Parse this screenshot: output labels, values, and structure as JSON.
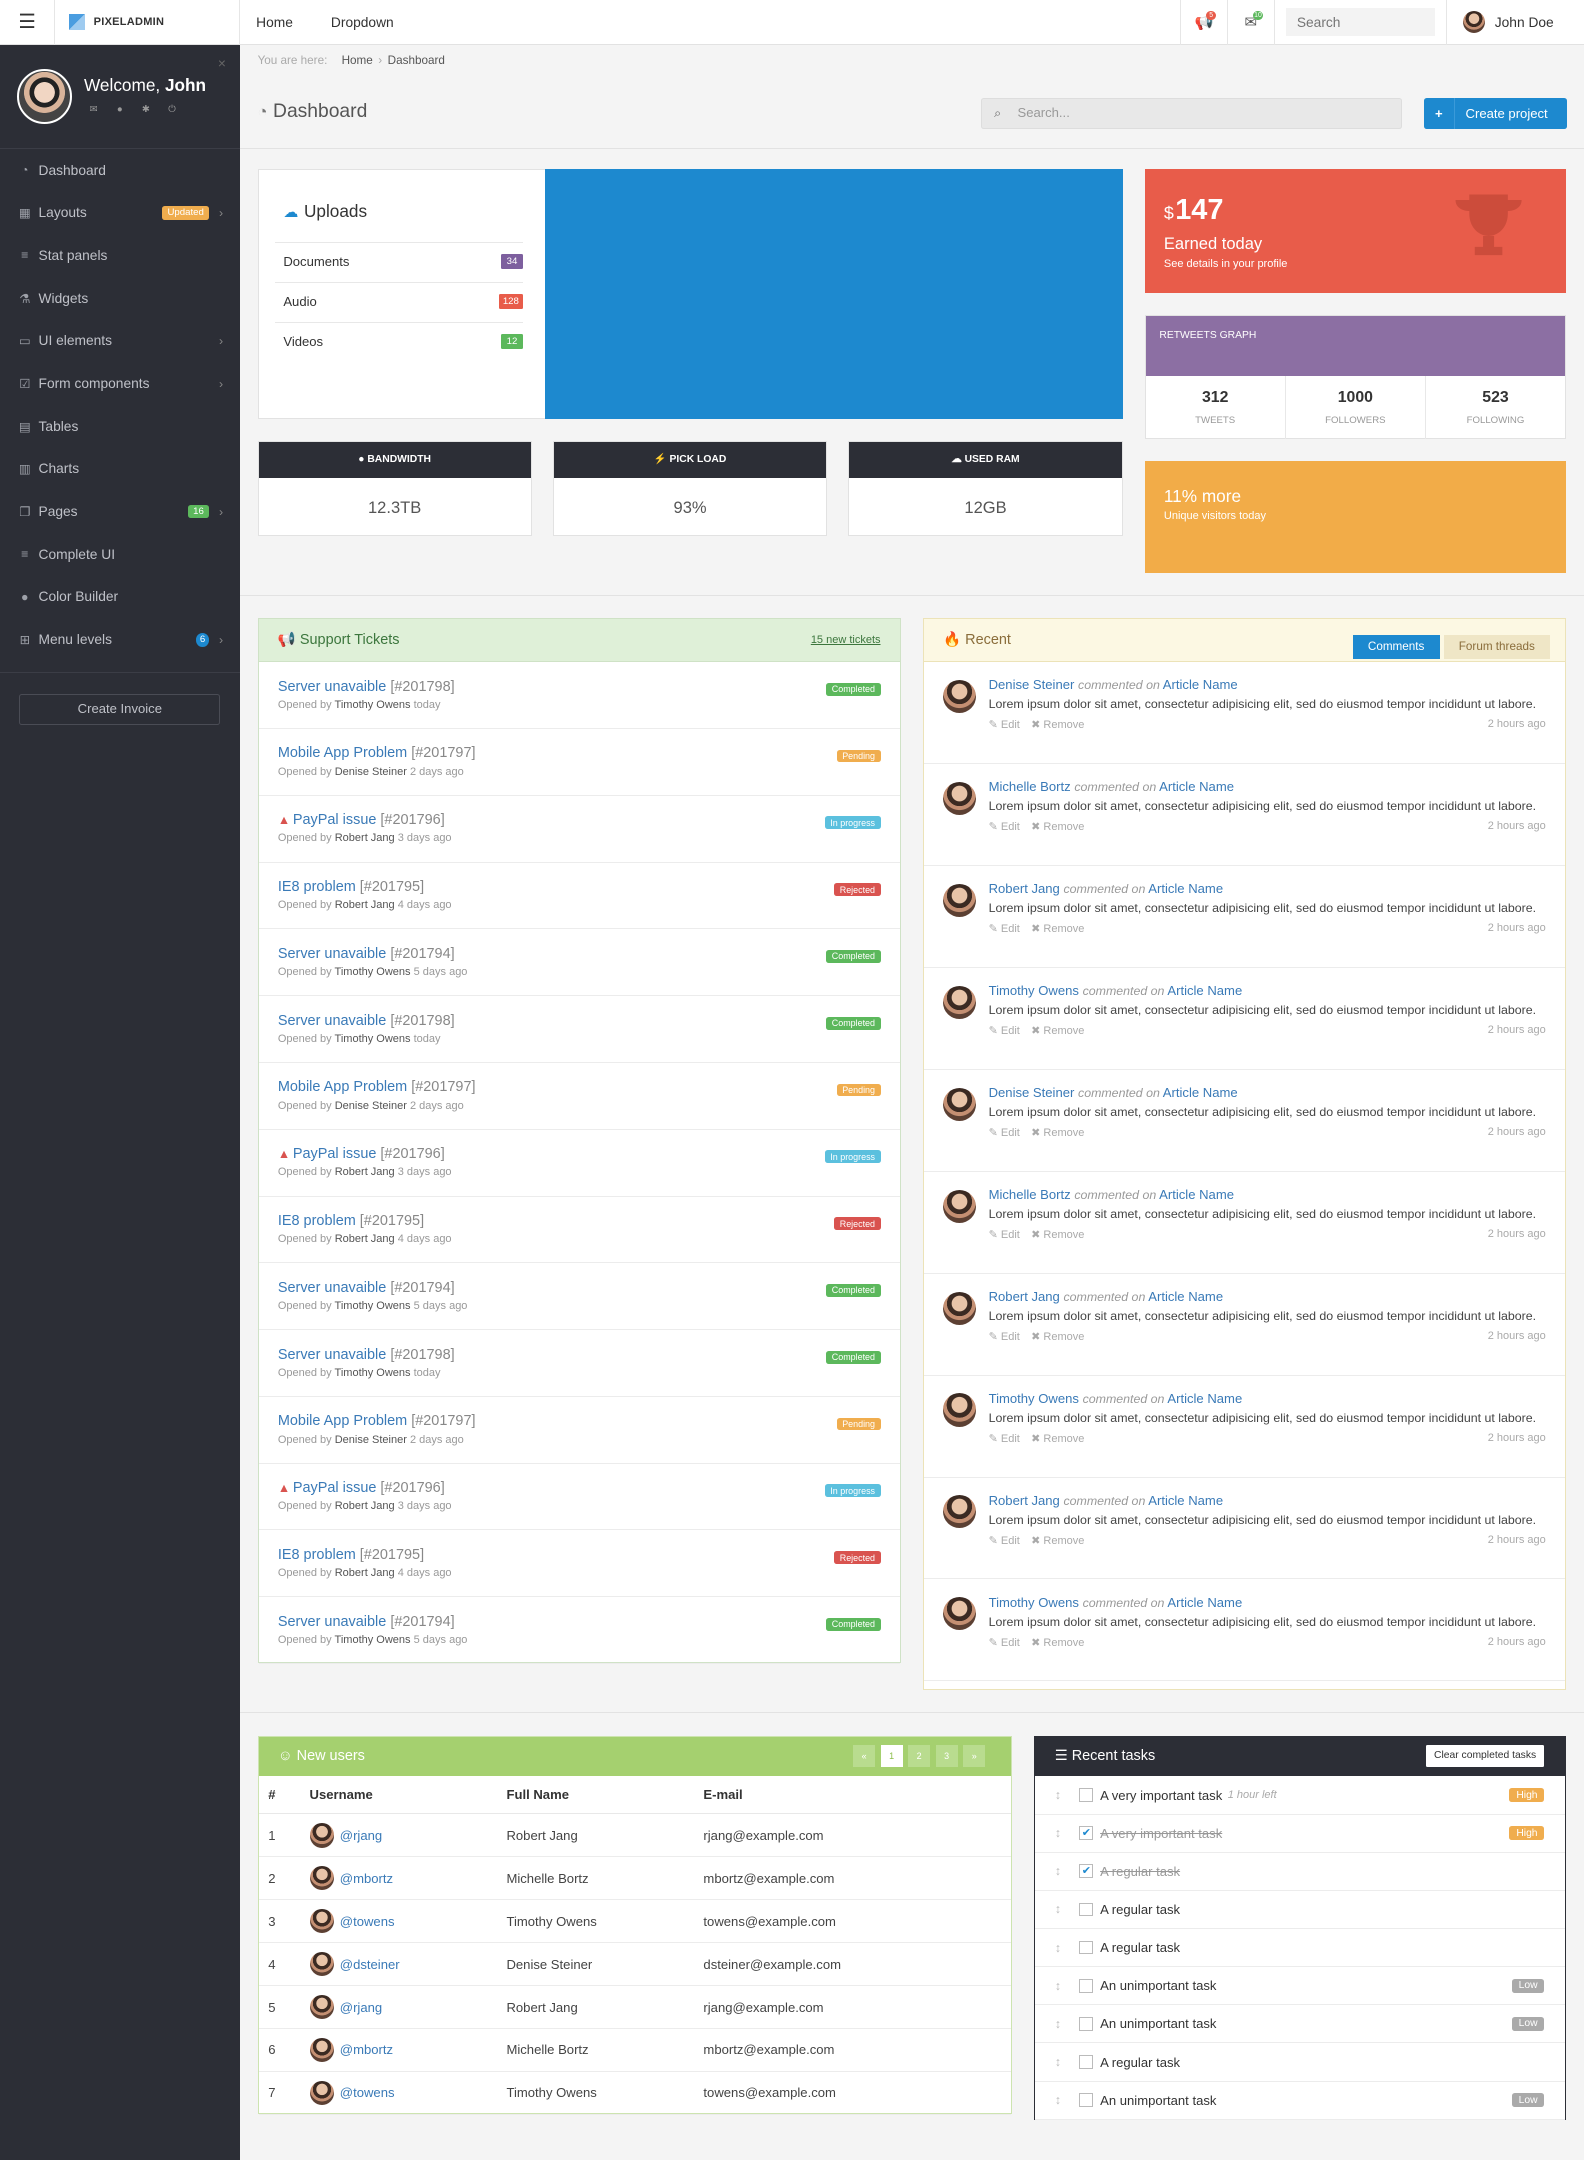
{
  "topbar": {
    "app": "PIXELADMIN",
    "nav": [
      "Home",
      "Dropdown"
    ],
    "search_placeholder": "Search",
    "user": "John Doe",
    "notif1": "5",
    "notif2": "10"
  },
  "sidebar": {
    "welcome": "Welcome,",
    "name": "John",
    "items": [
      {
        "label": "Dashboard",
        "icon": "dashboard-icon"
      },
      {
        "label": "Layouts",
        "icon": "grid-icon",
        "tag": "Updated",
        "chev": true
      },
      {
        "label": "Stat panels",
        "icon": "list-icon"
      },
      {
        "label": "Widgets",
        "icon": "flask-icon"
      },
      {
        "label": "UI elements",
        "icon": "desktop-icon",
        "chev": true
      },
      {
        "label": "Form components",
        "icon": "checkbox-icon",
        "chev": true
      },
      {
        "label": "Tables",
        "icon": "table-icon"
      },
      {
        "label": "Charts",
        "icon": "chart-icon"
      },
      {
        "label": "Pages",
        "icon": "files-icon",
        "tag": "16",
        "chev": true
      },
      {
        "label": "Complete UI",
        "icon": "list-icon"
      },
      {
        "label": "Color Builder",
        "icon": "drop-icon"
      },
      {
        "label": "Menu levels",
        "icon": "sitemap-icon",
        "tag": "6",
        "chev": true
      }
    ],
    "invoice": "Create Invoice"
  },
  "breadcrumb": {
    "prefix": "You are here:",
    "home": "Home",
    "current": "Dashboard"
  },
  "page": {
    "title": "Dashboard",
    "search_placeholder": "Search...",
    "create": "Create project"
  },
  "uploads": {
    "title": "Uploads",
    "rows": [
      {
        "label": "Documents",
        "count": "34",
        "color": "#7d5f9e"
      },
      {
        "label": "Audio",
        "count": "128",
        "color": "#e85c4a"
      },
      {
        "label": "Videos",
        "count": "12",
        "color": "#5cb85c"
      }
    ]
  },
  "stats": [
    {
      "label": "BANDWIDTH",
      "value": "12.3TB",
      "icon": "globe-icon"
    },
    {
      "label": "PICK LOAD",
      "value": "93%",
      "icon": "bolt-icon"
    },
    {
      "label": "USED RAM",
      "value": "12GB",
      "icon": "cloud-icon"
    }
  ],
  "earned": {
    "currency": "$",
    "value": "147",
    "label": "Earned today",
    "detail": "See details in your profile"
  },
  "retweets": {
    "title": "RETWEETS GRAPH",
    "cols": [
      {
        "v": "312",
        "l": "TWEETS"
      },
      {
        "v": "1000",
        "l": "FOLLOWERS"
      },
      {
        "v": "523",
        "l": "FOLLOWING"
      }
    ]
  },
  "visitors": {
    "title": "11% more",
    "sub": "Unique visitors today"
  },
  "tickets": {
    "title": "Support Tickets",
    "link": "15 new tickets",
    "opened": "Opened by",
    "items": [
      {
        "t": "Server unavaible",
        "n": "[#201798]",
        "by": "Timothy Owens",
        "when": "today",
        "s": "Completed",
        "c": "#5cb85c"
      },
      {
        "t": "Mobile App Problem",
        "n": "[#201797]",
        "by": "Denise Steiner",
        "when": "2 days ago",
        "s": "Pending",
        "c": "#f0ad4e"
      },
      {
        "t": "PayPal issue",
        "n": "[#201796]",
        "by": "Robert Jang",
        "when": "3 days ago",
        "s": "In progress",
        "c": "#5bc0de",
        "warn": true
      },
      {
        "t": "IE8 problem",
        "n": "[#201795]",
        "by": "Robert Jang",
        "when": "4 days ago",
        "s": "Rejected",
        "c": "#d9534f"
      },
      {
        "t": "Server unavaible",
        "n": "[#201794]",
        "by": "Timothy Owens",
        "when": "5 days ago",
        "s": "Completed",
        "c": "#5cb85c"
      },
      {
        "t": "Server unavaible",
        "n": "[#201798]",
        "by": "Timothy Owens",
        "when": "today",
        "s": "Completed",
        "c": "#5cb85c"
      },
      {
        "t": "Mobile App Problem",
        "n": "[#201797]",
        "by": "Denise Steiner",
        "when": "2 days ago",
        "s": "Pending",
        "c": "#f0ad4e"
      },
      {
        "t": "PayPal issue",
        "n": "[#201796]",
        "by": "Robert Jang",
        "when": "3 days ago",
        "s": "In progress",
        "c": "#5bc0de",
        "warn": true
      },
      {
        "t": "IE8 problem",
        "n": "[#201795]",
        "by": "Robert Jang",
        "when": "4 days ago",
        "s": "Rejected",
        "c": "#d9534f"
      },
      {
        "t": "Server unavaible",
        "n": "[#201794]",
        "by": "Timothy Owens",
        "when": "5 days ago",
        "s": "Completed",
        "c": "#5cb85c"
      },
      {
        "t": "Server unavaible",
        "n": "[#201798]",
        "by": "Timothy Owens",
        "when": "today",
        "s": "Completed",
        "c": "#5cb85c"
      },
      {
        "t": "Mobile App Problem",
        "n": "[#201797]",
        "by": "Denise Steiner",
        "when": "2 days ago",
        "s": "Pending",
        "c": "#f0ad4e"
      },
      {
        "t": "PayPal issue",
        "n": "[#201796]",
        "by": "Robert Jang",
        "when": "3 days ago",
        "s": "In progress",
        "c": "#5bc0de",
        "warn": true
      },
      {
        "t": "IE8 problem",
        "n": "[#201795]",
        "by": "Robert Jang",
        "when": "4 days ago",
        "s": "Rejected",
        "c": "#d9534f"
      },
      {
        "t": "Server unavaible",
        "n": "[#201794]",
        "by": "Timothy Owens",
        "when": "5 days ago",
        "s": "Completed",
        "c": "#5cb85c"
      }
    ]
  },
  "recent": {
    "title": "Recent",
    "tabs": [
      "Comments",
      "Forum threads"
    ],
    "verb": "commented on",
    "article": "Article Name",
    "text": "Lorem ipsum dolor sit amet, consectetur adipisicing elit, sed do eiusmod tempor incididunt ut labore.",
    "edit": "Edit",
    "remove": "Remove",
    "time": "2 hours ago",
    "authors": [
      "Denise Steiner",
      "Michelle Bortz",
      "Robert Jang",
      "Timothy Owens",
      "Denise Steiner",
      "Michelle Bortz",
      "Robert Jang",
      "Timothy Owens",
      "Robert Jang",
      "Timothy Owens"
    ]
  },
  "users": {
    "title": "New users",
    "pages": [
      "«",
      "1",
      "2",
      "3",
      "»"
    ],
    "headers": [
      "#",
      "Username",
      "Full Name",
      "E-mail"
    ],
    "rows": [
      [
        "1",
        "@rjang",
        "Robert Jang",
        "rjang@example.com"
      ],
      [
        "2",
        "@mbortz",
        "Michelle Bortz",
        "mbortz@example.com"
      ],
      [
        "3",
        "@towens",
        "Timothy Owens",
        "towens@example.com"
      ],
      [
        "4",
        "@dsteiner",
        "Denise Steiner",
        "dsteiner@example.com"
      ],
      [
        "5",
        "@rjang",
        "Robert Jang",
        "rjang@example.com"
      ],
      [
        "6",
        "@mbortz",
        "Michelle Bortz",
        "mbortz@example.com"
      ],
      [
        "7",
        "@towens",
        "Timothy Owens",
        "towens@example.com"
      ]
    ]
  },
  "tasks": {
    "title": "Recent tasks",
    "clear": "Clear completed tasks",
    "items": [
      {
        "t": "A very important task",
        "note": "1 hour left",
        "done": false,
        "p": "High",
        "c": "#f0ad4e"
      },
      {
        "t": "A very important task",
        "done": true,
        "p": "High",
        "c": "#f0ad4e"
      },
      {
        "t": "A regular task",
        "done": true
      },
      {
        "t": "A regular task",
        "done": false
      },
      {
        "t": "A regular task",
        "done": false
      },
      {
        "t": "An unimportant task",
        "done": false,
        "p": "Low",
        "c": "#aaaaaa"
      },
      {
        "t": "An unimportant task",
        "done": false,
        "p": "Low",
        "c": "#aaaaaa"
      },
      {
        "t": "A regular task",
        "done": false
      },
      {
        "t": "An unimportant task",
        "done": false,
        "p": "Low",
        "c": "#aaaaaa"
      }
    ]
  }
}
